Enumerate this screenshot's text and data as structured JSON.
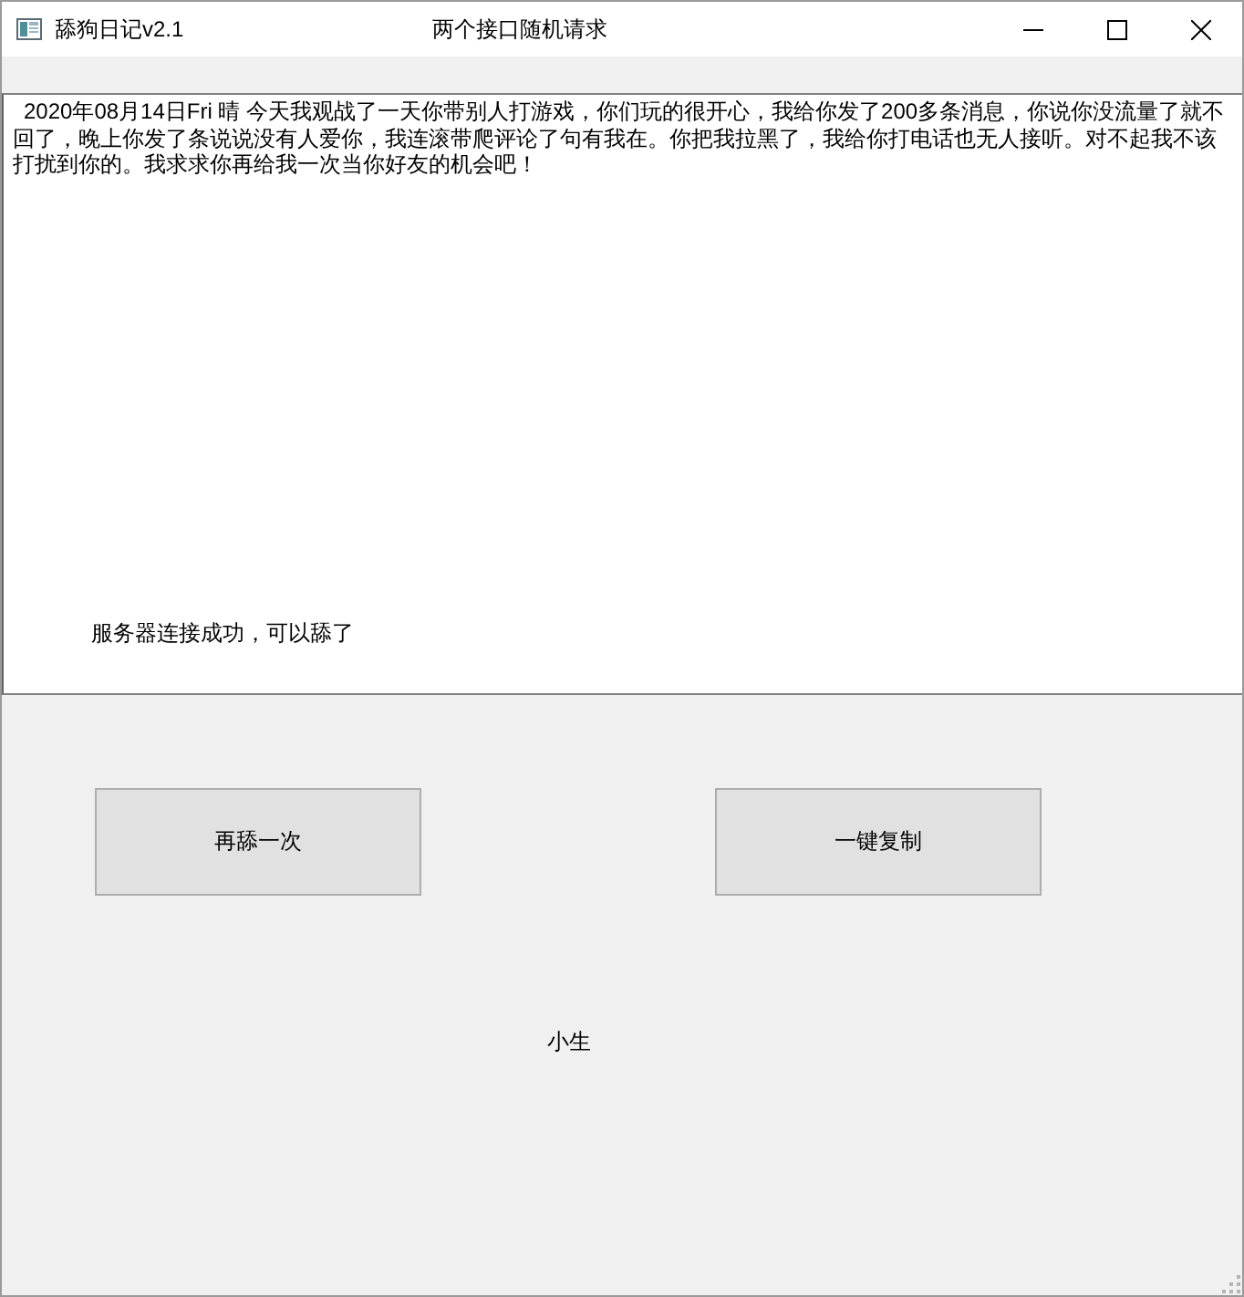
{
  "window": {
    "title": "舔狗日记v2.1",
    "caption": "两个接口随机请求"
  },
  "diary": {
    "value": "2020年08月14日Fri 晴 今天我观战了一天你带别人打游戏，你们玩的很开心，我给你发了200多条消息，你说你没流量了就不回了，晚上你发了条说说没有人爱你，我连滚带爬评论了句有我在。你把我拉黑了，我给你打电话也无人接听。对不起我不该打扰到你的。我求求你再给我一次当你好友的机会吧！"
  },
  "status_label": "服务器连接成功，可以舔了",
  "buttons": [
    {
      "label": "再舔一次"
    },
    {
      "label": "一键复制"
    }
  ],
  "author_label": "小生"
}
